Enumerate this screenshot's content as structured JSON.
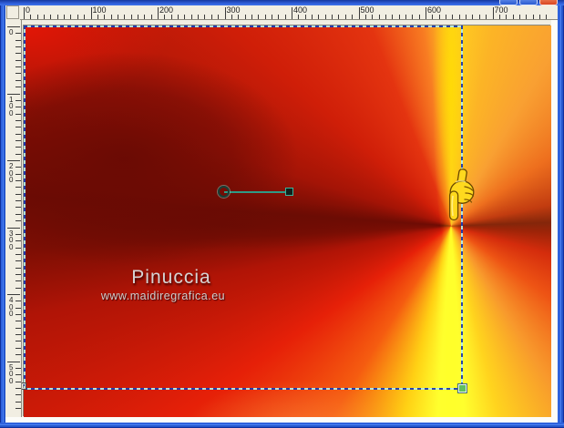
{
  "window": {
    "app": "graphics-editor-image-window",
    "titlebar_buttons": [
      {
        "name": "minimize-button",
        "style": "blue"
      },
      {
        "name": "maximize-button",
        "style": "blue"
      },
      {
        "name": "close-button",
        "style": "red"
      }
    ],
    "border_color": "#2456cc"
  },
  "rulers": {
    "horizontal": {
      "labels": [
        "0",
        "100",
        "200",
        "300",
        "400",
        "500",
        "600",
        "700"
      ]
    },
    "vertical": {
      "labels": [
        "0",
        "100",
        "200",
        "300",
        "400",
        "500"
      ]
    }
  },
  "canvas": {
    "watermark_title": "Pinuccia",
    "watermark_url": "www.maidiregrafica.eu",
    "gradient_colors": {
      "bright_red": "#e41a06",
      "dark_red": "#6e0c04",
      "bright_yellow": "#ffff2e",
      "gold": "#ffd020",
      "orange": "#f9a032"
    }
  },
  "selection": {
    "style": "marching-ants",
    "dash_dark": "#1c3bb4",
    "dash_light": "#b4ece6",
    "handle_fill": "#5fc05f",
    "handles": [
      "bottom-left",
      "bottom-right"
    ]
  },
  "gradient_control": {
    "line_color": "#2f9a86",
    "endpoints": [
      "circle-endpoint",
      "square-endpoint"
    ]
  },
  "hand_icon": {
    "fill": "#ffd91e",
    "outline": "#6b4a00"
  }
}
